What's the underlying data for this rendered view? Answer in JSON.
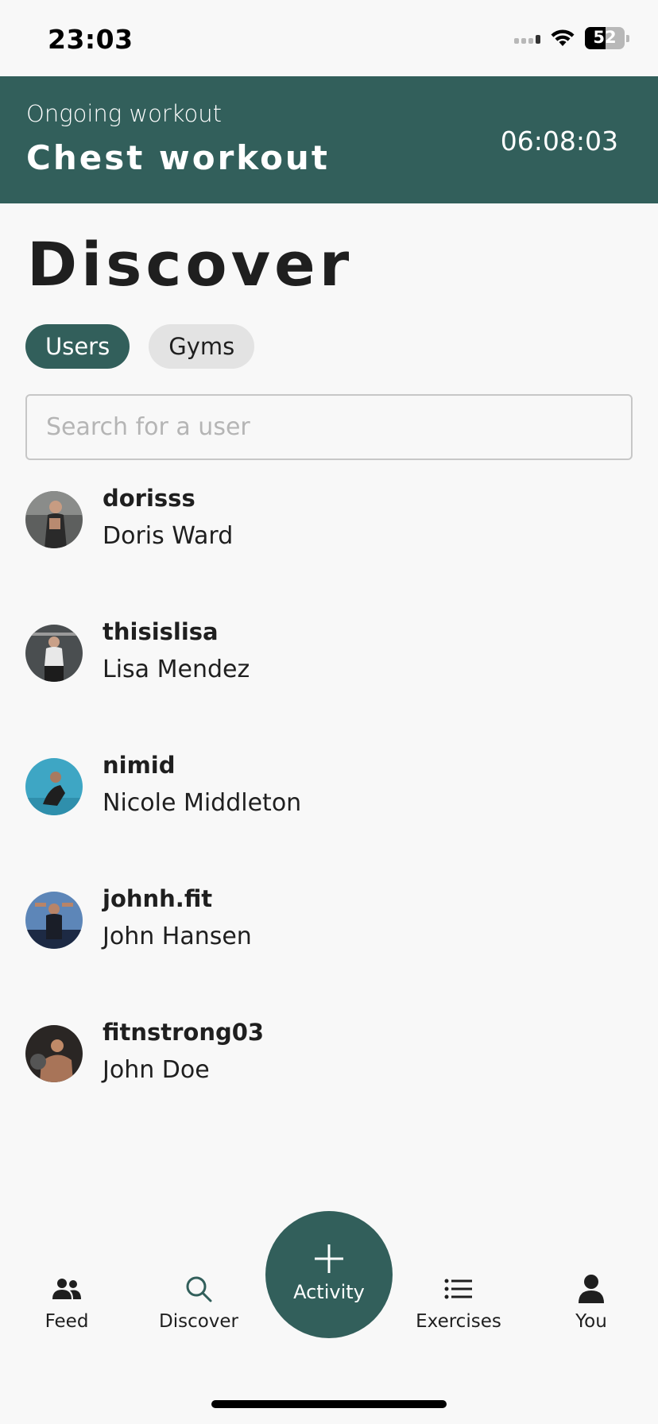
{
  "colors": {
    "accent": "#325f5b",
    "text": "#1f1f1f",
    "tab_inactive": "#e3e3e3"
  },
  "status_bar": {
    "time": "23:03",
    "battery": "52",
    "battery_level_percent": 52
  },
  "workout_banner": {
    "subtitle": "Ongoing workout",
    "title": "Chest workout",
    "timer": "06:08:03"
  },
  "page": {
    "title": "Discover"
  },
  "tabs": [
    {
      "label": "Users",
      "active": true
    },
    {
      "label": "Gyms",
      "active": false
    }
  ],
  "search": {
    "placeholder": "Search for a user",
    "value": ""
  },
  "users": [
    {
      "handle": "dorisss",
      "name": "Doris Ward"
    },
    {
      "handle": "thisislisa",
      "name": "Lisa Mendez"
    },
    {
      "handle": "nimid",
      "name": "Nicole Middleton"
    },
    {
      "handle": "johnh.fit",
      "name": "John Hansen"
    },
    {
      "handle": "fitnstrong03",
      "name": "John Doe"
    }
  ],
  "nav": {
    "feed": {
      "label": "Feed",
      "icon": "users-icon"
    },
    "discover": {
      "label": "Discover",
      "icon": "search-icon",
      "active": true
    },
    "activity": {
      "label": "Activity",
      "icon": "plus-icon"
    },
    "exercises": {
      "label": "Exercises",
      "icon": "list-icon"
    },
    "you": {
      "label": "You",
      "icon": "person-icon"
    }
  }
}
